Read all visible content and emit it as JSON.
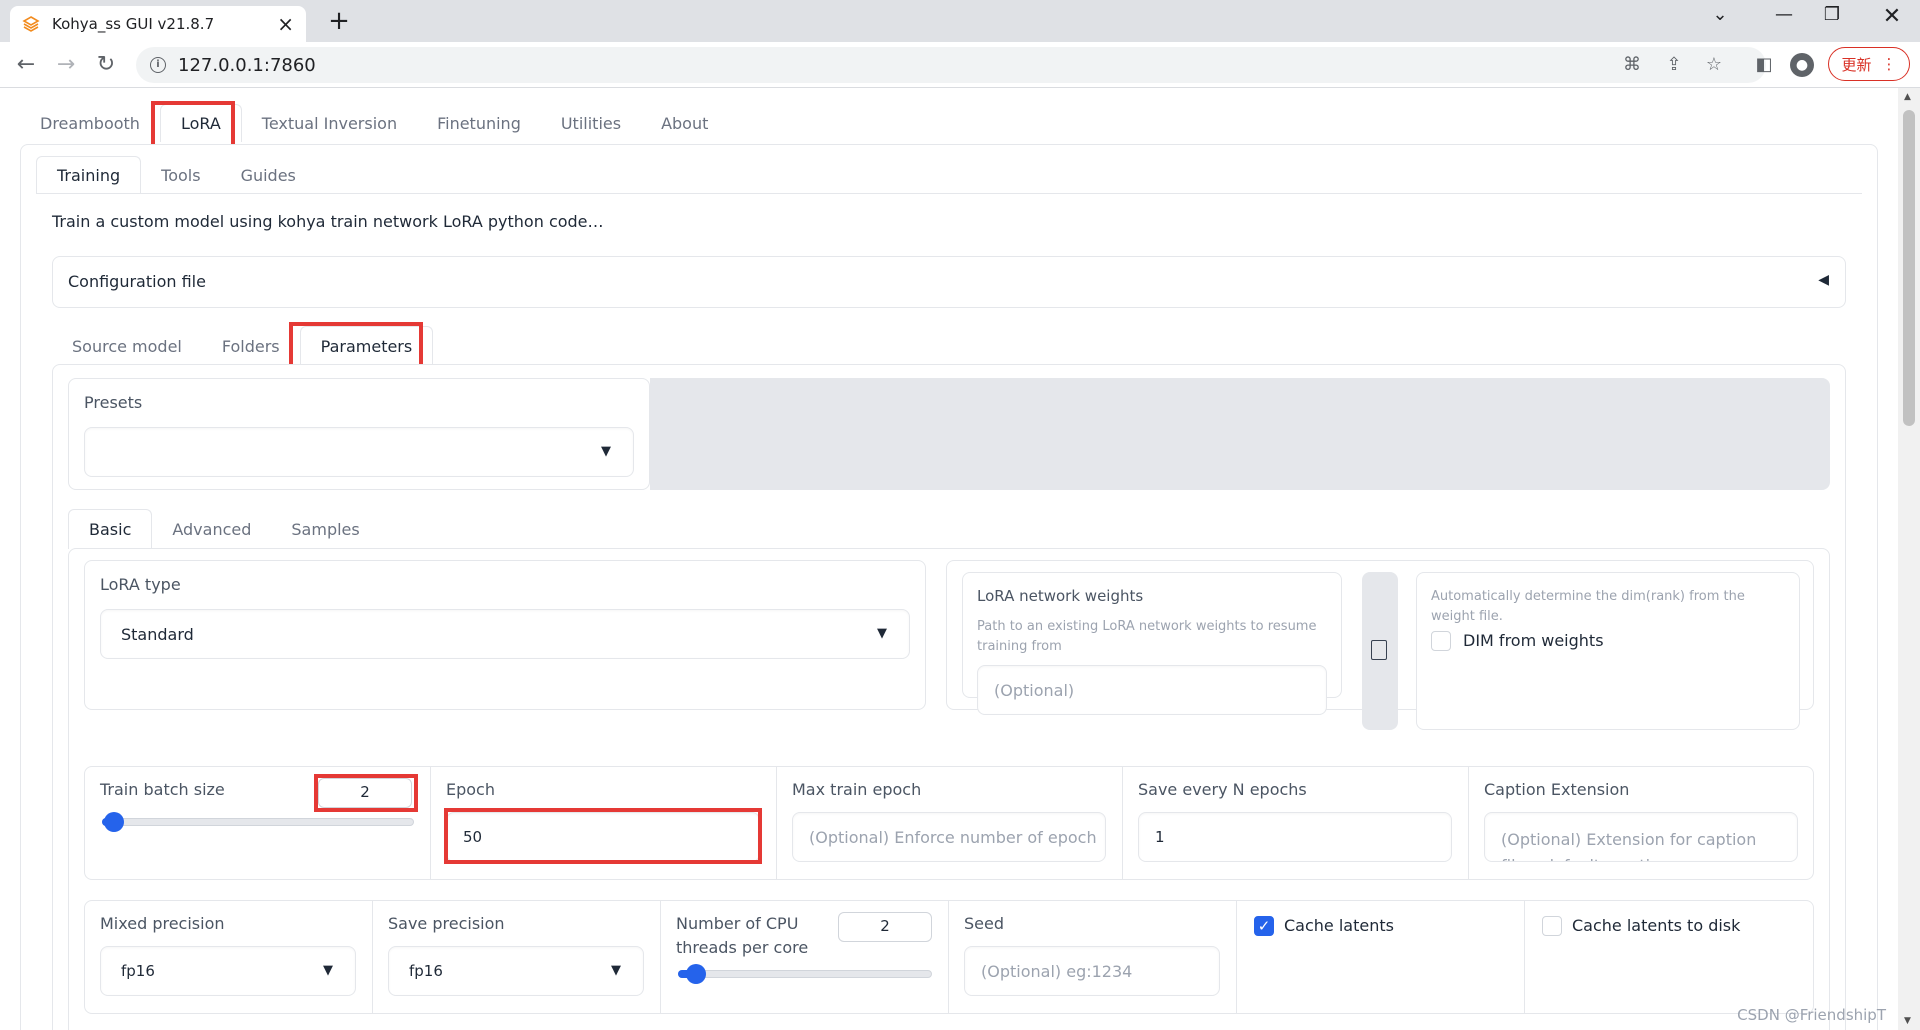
{
  "browser": {
    "tab_title": "Kohya_ss GUI v21.8.7",
    "url": "127.0.0.1:7860",
    "update_label": "更新"
  },
  "main_tabs": [
    "Dreambooth",
    "LoRA",
    "Textual Inversion",
    "Finetuning",
    "Utilities",
    "About"
  ],
  "sub_tabs": [
    "Training",
    "Tools",
    "Guides"
  ],
  "description": "Train a custom model using kohya train network LoRA python code…",
  "config_file": {
    "label": "Configuration file"
  },
  "config_tabs": [
    "Source model",
    "Folders",
    "Parameters"
  ],
  "presets": {
    "label": "Presets",
    "value": ""
  },
  "param_tabs": [
    "Basic",
    "Advanced",
    "Samples"
  ],
  "lora_type": {
    "label": "LoRA type",
    "value": "Standard"
  },
  "network_weights": {
    "label": "LoRA network weights",
    "info": "Path to an existing LoRA network weights to resume training from",
    "placeholder": "(Optional)"
  },
  "dim_from_weights": {
    "info": "Automatically determine the dim(rank) from the weight file.",
    "label": "DIM from weights",
    "checked": false
  },
  "train_batch_size": {
    "label": "Train batch size",
    "value": "2",
    "slider_fraction": 0.04
  },
  "epoch": {
    "label": "Epoch",
    "value": "50"
  },
  "max_train_epoch": {
    "label": "Max train epoch",
    "placeholder": "(Optional) Enforce number of epoch"
  },
  "save_every_n_epochs": {
    "label": "Save every N epochs",
    "value": "1"
  },
  "caption_extension": {
    "label": "Caption Extension",
    "placeholder": "(Optional) Extension for caption files. default: caption"
  },
  "mixed_precision": {
    "label": "Mixed precision",
    "value": "fp16"
  },
  "save_precision": {
    "label": "Save precision",
    "value": "fp16"
  },
  "cpu_threads": {
    "label_line1": "Number of CPU",
    "label_line2": "threads per core",
    "value": "2",
    "slider_fraction": 0.07
  },
  "seed": {
    "label": "Seed",
    "placeholder": "(Optional) eg:1234"
  },
  "cache_latents": {
    "label": "Cache latents",
    "checked": true
  },
  "cache_latents_to_disk": {
    "label": "Cache latents to disk",
    "checked": false
  },
  "watermark": "CSDN @FriendshipT",
  "colors": {
    "accent": "#2563eb",
    "highlight": "#e53935"
  }
}
